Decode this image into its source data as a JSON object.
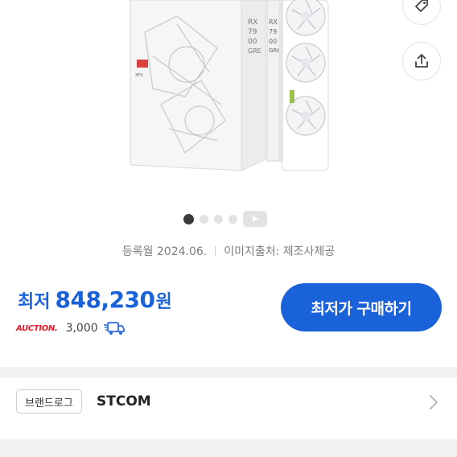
{
  "gallery": {
    "box_text": "RX 7900 GRE",
    "total_images": 5,
    "active_index": 0,
    "last_is_video": true
  },
  "meta": {
    "registered": "등록월 2024.06.",
    "image_source": "이미지출처: 제조사제공"
  },
  "price": {
    "label": "최저",
    "value": "848,230",
    "unit": "원"
  },
  "mall": {
    "logo": "AUCTION.",
    "shipping": "3,000"
  },
  "buy_button": "최저가 구매하기",
  "brand": {
    "chip": "브랜드로그",
    "name": "STCOM"
  },
  "colors": {
    "accent": "#1a62d9",
    "auction": "#e7182a"
  }
}
